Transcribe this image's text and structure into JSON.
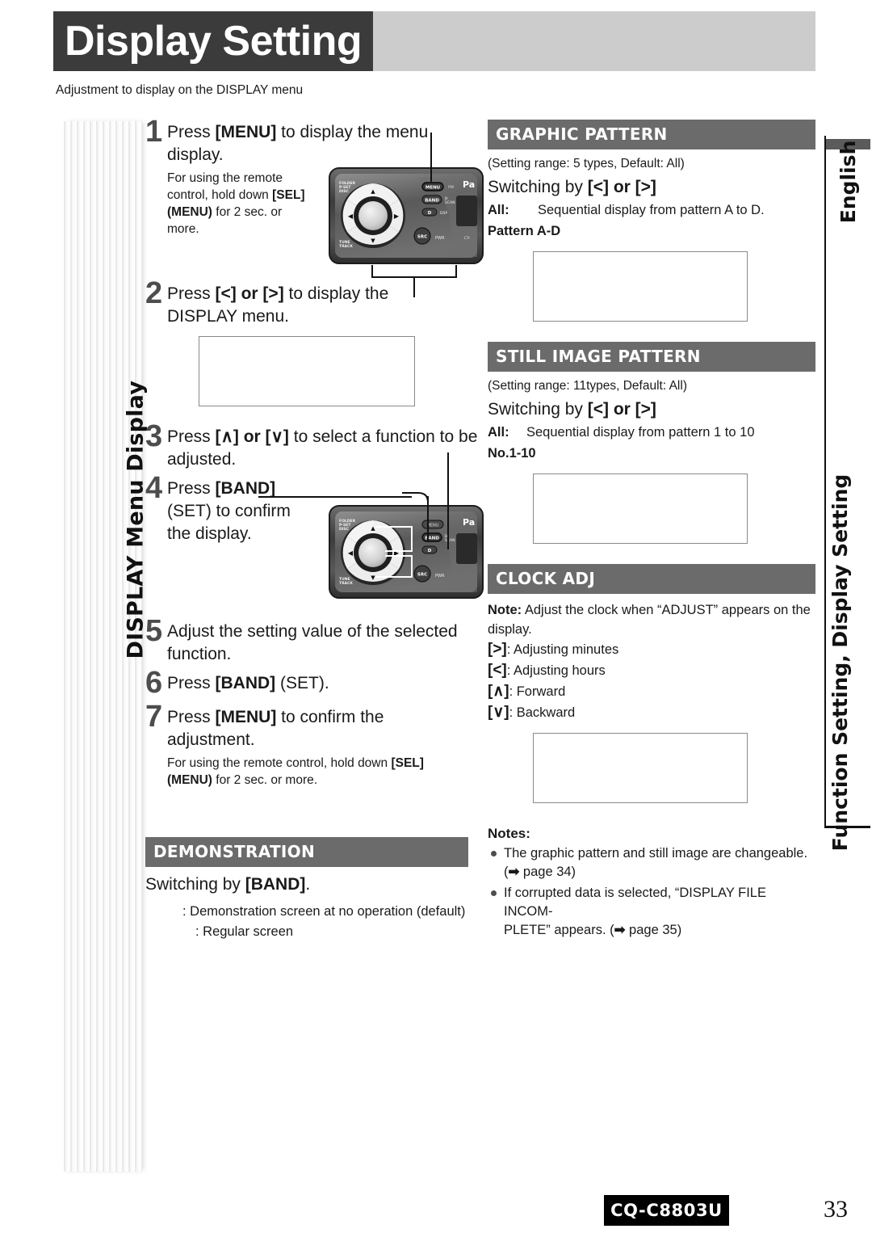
{
  "header": {
    "title": "Display Setting",
    "subtitle": "Adjustment to display on the DISPLAY menu"
  },
  "side_tabs": {
    "language": "English",
    "section": "Function Setting, Display Setting",
    "left_band": "DISPLAY Menu Display"
  },
  "steps": [
    {
      "num": "1",
      "main_pre": "Press ",
      "main_key": "[MENU]",
      "main_post": " to display the menu display.",
      "note": "For using the remote control, hold down [SEL] (MENU) for 2 sec. or more."
    },
    {
      "num": "2",
      "main_pre": "Press ",
      "main_key": "[<] or [>]",
      "main_post": " to display the DISPLAY menu."
    },
    {
      "num": "3",
      "main_pre": "Press ",
      "main_key": "[∧] or [∨]",
      "main_post": " to select a function to be adjusted."
    },
    {
      "num": "4",
      "main_pre": "Press ",
      "main_key": "[BAND]",
      "main_post": " (SET) to confirm the display."
    },
    {
      "num": "5",
      "main_pre": "Adjust the setting value of the selected function.",
      "main_key": "",
      "main_post": ""
    },
    {
      "num": "6",
      "main_pre": "Press ",
      "main_key": "[BAND]",
      "main_post": " (SET)."
    },
    {
      "num": "7",
      "main_pre": "Press ",
      "main_key": "[MENU]",
      "main_post": " to confirm the adjustment.",
      "note": "For using the remote control, hold down [SEL] (MENU) for 2 sec. or more."
    }
  ],
  "demonstration": {
    "heading": "DEMONSTRATION",
    "switching": "Switching by [BAND].",
    "options": [
      ": Demonstration screen at no operation (default)",
      ": Regular screen"
    ]
  },
  "graphic_pattern": {
    "heading": "GRAPHIC PATTERN",
    "range": "(Setting range: 5 types, Default: All)",
    "switching": "Switching by [<] or [>]",
    "all_key": "All",
    "all_desc": "Sequential display from pattern A to D.",
    "pattern_label": "Pattern A-D"
  },
  "still_image_pattern": {
    "heading": "STILL IMAGE PATTERN",
    "range": "(Setting range: 11types, Default: All)",
    "switching": "Switching by [<] or [>]",
    "all_key": "All",
    "all_desc": "Sequential display from pattern 1 to 10",
    "pattern_label": "No.1-10"
  },
  "clock_adj": {
    "heading": "CLOCK ADJ",
    "note_label": "Note:",
    "note_text": " Adjust the clock when “ADJUST” appears on the display.",
    "lines": [
      {
        "key": "[>]",
        "desc": ": Adjusting minutes"
      },
      {
        "key": "[<]",
        "desc": ": Adjusting hours"
      },
      {
        "key": "[∧]",
        "desc": ": Forward"
      },
      {
        "key": "[∨]",
        "desc": ": Backward"
      }
    ]
  },
  "notes": {
    "title": "Notes:",
    "items": [
      "The graphic pattern and still image are changeable. (➡ page 34)",
      "If corrupted data is selected, “DISPLAY FILE INCOM-PLETE” appears. (➡ page 35)"
    ]
  },
  "device_labels": {
    "menu": "MENU",
    "band": "BAND",
    "d": "D",
    "disp": "DSP",
    "src": "SRC",
    "pwr": "PWR",
    "folder": "FOLDER",
    "pset": "P·SET",
    "disc": "DISC",
    "tune": "TUNE",
    "track": "TRACK",
    "brand": "Pa"
  },
  "footer": {
    "model": "CQ-C8803U",
    "page": "33"
  }
}
